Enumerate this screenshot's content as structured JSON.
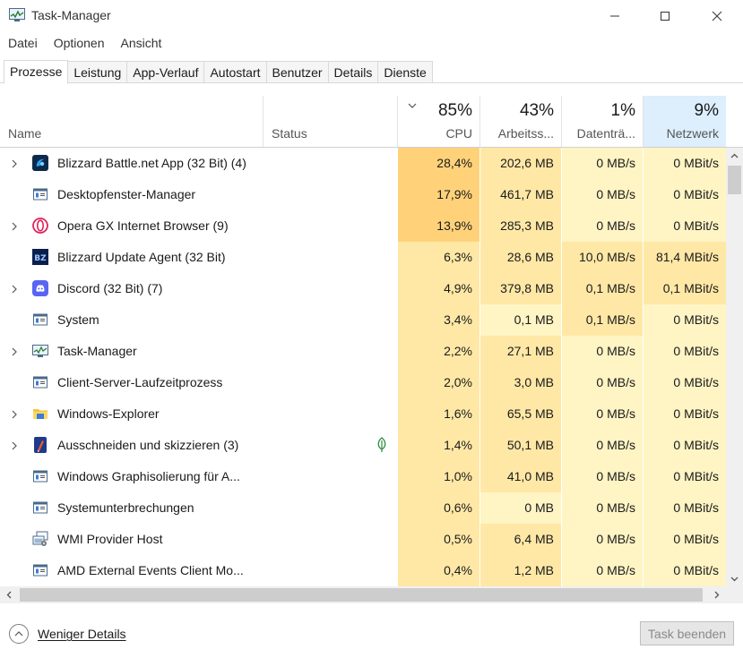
{
  "window": {
    "title": "Task-Manager",
    "icon": "task-manager-icon"
  },
  "menu": [
    "Datei",
    "Optionen",
    "Ansicht"
  ],
  "tabs": [
    {
      "label": "Prozesse",
      "active": true
    },
    {
      "label": "Leistung",
      "active": false
    },
    {
      "label": "App-Verlauf",
      "active": false
    },
    {
      "label": "Autostart",
      "active": false
    },
    {
      "label": "Benutzer",
      "active": false
    },
    {
      "label": "Details",
      "active": false
    },
    {
      "label": "Dienste",
      "active": false
    }
  ],
  "columns": {
    "name": "Name",
    "status": "Status",
    "cpu": {
      "label": "CPU",
      "percent": "85%",
      "sorted": true
    },
    "memory": {
      "label": "Arbeitss...",
      "percent": "43%"
    },
    "disk": {
      "label": "Datenträ...",
      "percent": "1%"
    },
    "network": {
      "label": "Netzwerk",
      "percent": "9%"
    }
  },
  "colors": {
    "heat_high": "#ffd27a",
    "heat_mid": "#ffe8a6",
    "heat_low": "#fff4c4",
    "network_header": "#ddeefd",
    "selected_tab_border": "#d9d9d9"
  },
  "processes": [
    {
      "name": "Blizzard Battle.net App (32 Bit) (4)",
      "icon": "battlenet-icon",
      "expandable": true,
      "status": "",
      "cpu": "28,4%",
      "memory": "202,6 MB",
      "disk": "0 MB/s",
      "network": "0 MBit/s",
      "heat": [
        "high",
        "mid",
        "low",
        "low"
      ]
    },
    {
      "name": "Desktopfenster-Manager",
      "icon": "window-app-icon",
      "expandable": false,
      "status": "",
      "cpu": "17,9%",
      "memory": "461,7 MB",
      "disk": "0 MB/s",
      "network": "0 MBit/s",
      "heat": [
        "high",
        "mid",
        "low",
        "low"
      ]
    },
    {
      "name": "Opera GX Internet Browser (9)",
      "icon": "opera-gx-icon",
      "expandable": true,
      "status": "",
      "cpu": "13,9%",
      "memory": "285,3 MB",
      "disk": "0 MB/s",
      "network": "0 MBit/s",
      "heat": [
        "high",
        "mid",
        "low",
        "low"
      ]
    },
    {
      "name": "Blizzard Update Agent (32 Bit)",
      "icon": "blizzard-agent-icon",
      "expandable": false,
      "status": "",
      "cpu": "6,3%",
      "memory": "28,6 MB",
      "disk": "10,0 MB/s",
      "network": "81,4 MBit/s",
      "heat": [
        "mid",
        "mid",
        "mid",
        "mid"
      ]
    },
    {
      "name": "Discord (32 Bit) (7)",
      "icon": "discord-icon",
      "expandable": true,
      "status": "",
      "cpu": "4,9%",
      "memory": "379,8 MB",
      "disk": "0,1 MB/s",
      "network": "0,1 MBit/s",
      "heat": [
        "mid",
        "mid",
        "mid",
        "mid"
      ]
    },
    {
      "name": "System",
      "icon": "window-app-icon",
      "expandable": false,
      "status": "",
      "cpu": "3,4%",
      "memory": "0,1 MB",
      "disk": "0,1 MB/s",
      "network": "0 MBit/s",
      "heat": [
        "mid",
        "low",
        "mid",
        "low"
      ]
    },
    {
      "name": "Task-Manager",
      "icon": "task-manager-icon",
      "expandable": true,
      "status": "",
      "cpu": "2,2%",
      "memory": "27,1 MB",
      "disk": "0 MB/s",
      "network": "0 MBit/s",
      "heat": [
        "mid",
        "mid",
        "low",
        "low"
      ]
    },
    {
      "name": "Client-Server-Laufzeitprozess",
      "icon": "window-app-icon",
      "expandable": false,
      "status": "",
      "cpu": "2,0%",
      "memory": "3,0 MB",
      "disk": "0 MB/s",
      "network": "0 MBit/s",
      "heat": [
        "mid",
        "mid",
        "low",
        "low"
      ]
    },
    {
      "name": "Windows-Explorer",
      "icon": "folder-icon",
      "expandable": true,
      "status": "",
      "cpu": "1,6%",
      "memory": "65,5 MB",
      "disk": "0 MB/s",
      "network": "0 MBit/s",
      "heat": [
        "mid",
        "mid",
        "low",
        "low"
      ]
    },
    {
      "name": "Ausschneiden und skizzieren (3)",
      "icon": "snip-sketch-icon",
      "expandable": true,
      "status": "leaf",
      "cpu": "1,4%",
      "memory": "50,1 MB",
      "disk": "0 MB/s",
      "network": "0 MBit/s",
      "heat": [
        "mid",
        "mid",
        "low",
        "low"
      ]
    },
    {
      "name": "Windows Graphisolierung für A...",
      "icon": "window-app-icon",
      "expandable": false,
      "status": "",
      "cpu": "1,0%",
      "memory": "41,0 MB",
      "disk": "0 MB/s",
      "network": "0 MBit/s",
      "heat": [
        "mid",
        "mid",
        "low",
        "low"
      ]
    },
    {
      "name": "Systemunterbrechungen",
      "icon": "window-app-icon",
      "expandable": false,
      "status": "",
      "cpu": "0,6%",
      "memory": "0 MB",
      "disk": "0 MB/s",
      "network": "0 MBit/s",
      "heat": [
        "mid",
        "low",
        "low",
        "low"
      ]
    },
    {
      "name": "WMI Provider Host",
      "icon": "wmi-host-icon",
      "expandable": false,
      "status": "",
      "cpu": "0,5%",
      "memory": "6,4 MB",
      "disk": "0 MB/s",
      "network": "0 MBit/s",
      "heat": [
        "mid",
        "mid",
        "low",
        "low"
      ]
    },
    {
      "name": "AMD External Events Client Mo...",
      "icon": "window-app-icon",
      "expandable": false,
      "status": "",
      "cpu": "0,4%",
      "memory": "1,2 MB",
      "disk": "0 MB/s",
      "network": "0 MBit/s",
      "heat": [
        "mid",
        "mid",
        "low",
        "low"
      ]
    }
  ],
  "footer": {
    "fewer_details": "Weniger Details",
    "end_task": "Task beenden"
  }
}
